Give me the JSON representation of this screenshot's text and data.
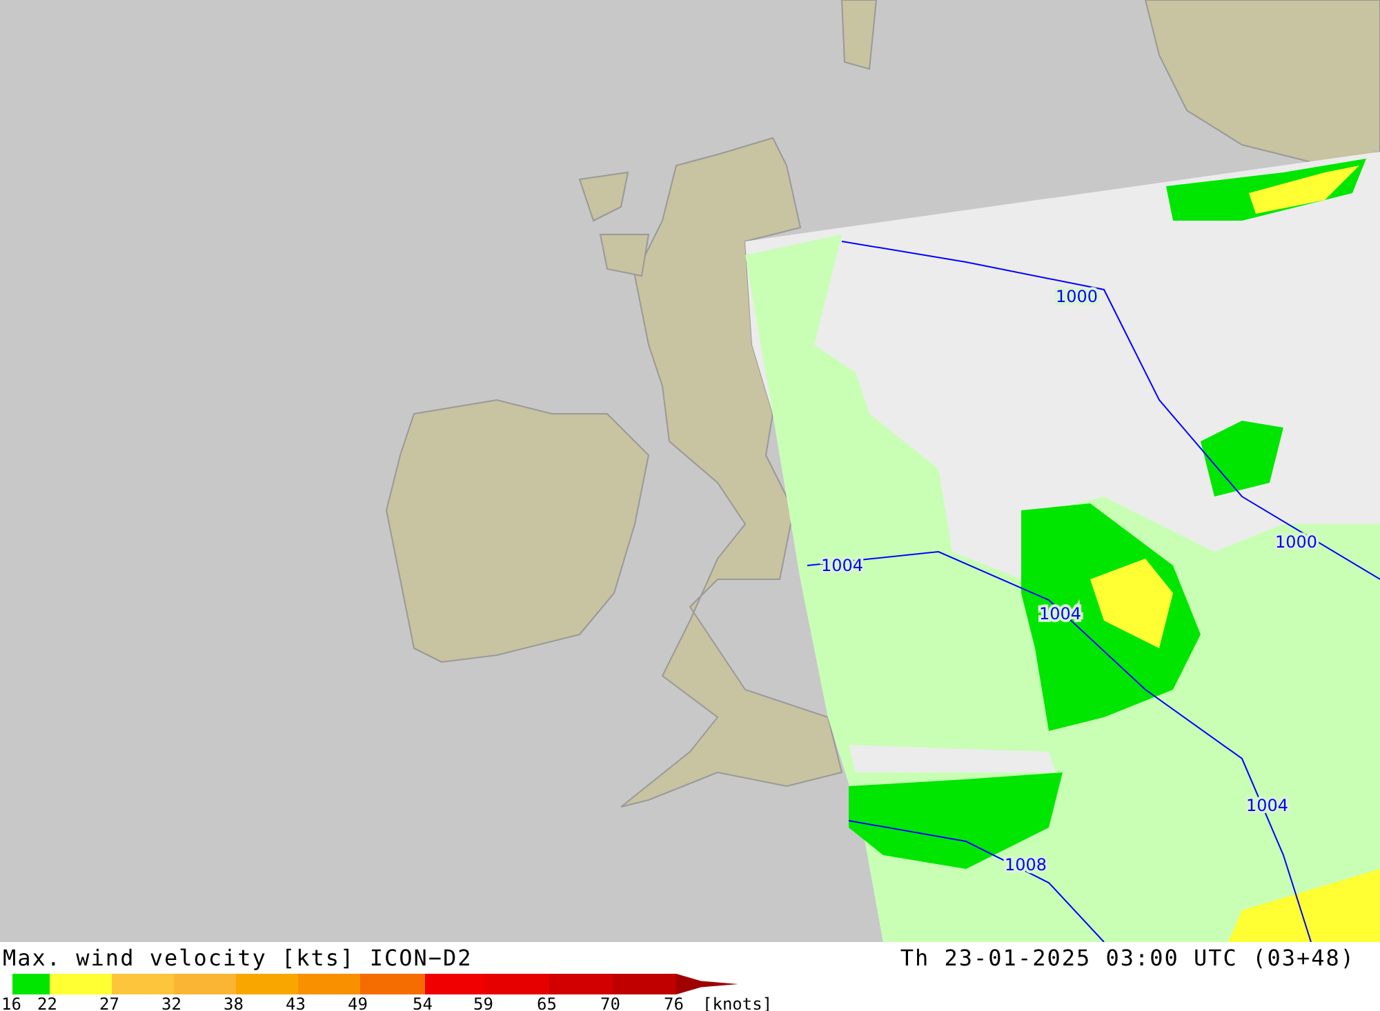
{
  "map": {
    "isobar_labels": [
      "1000",
      "1000",
      "1004",
      "1004",
      "1004",
      "1008"
    ]
  },
  "title": "Max. wind velocity [kts] ICON−D2",
  "valid_time": "Th 23-01-2025 03:00 UTC (03+48)",
  "legend": {
    "bins": [
      {
        "color": "#00e600"
      },
      {
        "color": "#ffff33"
      },
      {
        "color": "#fcc53c"
      },
      {
        "color": "#fbb535"
      },
      {
        "color": "#f9a600"
      },
      {
        "color": "#f89000"
      },
      {
        "color": "#f56c00"
      },
      {
        "color": "#f00000"
      },
      {
        "color": "#e60000"
      },
      {
        "color": "#d20000"
      },
      {
        "color": "#c00000"
      },
      {
        "color": "#a00000"
      }
    ],
    "labels": [
      "16",
      "22",
      "27",
      "32",
      "38",
      "43",
      "49",
      "54",
      "59",
      "65",
      "70",
      "76",
      "[knots]"
    ]
  }
}
